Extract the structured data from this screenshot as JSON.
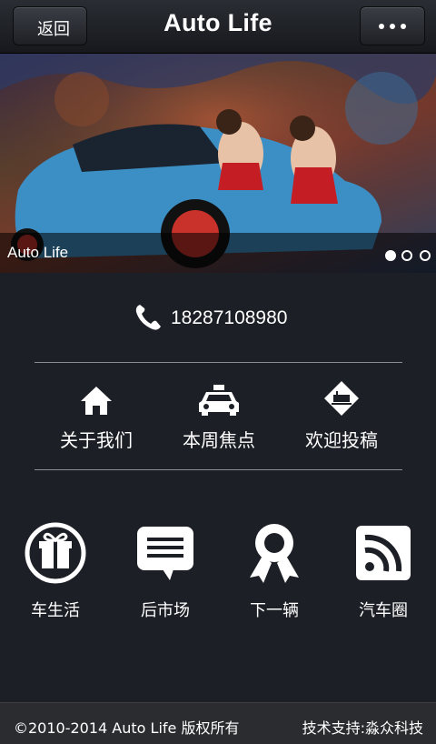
{
  "header": {
    "back_label": "返回",
    "title": "Auto Life",
    "more_icon": "ellipsis-icon"
  },
  "banner": {
    "caption": "Auto Life",
    "slides": 3,
    "active_slide": 1
  },
  "contact": {
    "phone_icon": "phone-icon",
    "phone": "18287108980"
  },
  "nav": [
    {
      "icon": "home-icon",
      "label": "关于我们"
    },
    {
      "icon": "taxi-icon",
      "label": "本周焦点"
    },
    {
      "icon": "train-sign-icon",
      "label": "欢迎投稿"
    }
  ],
  "grid": [
    {
      "icon": "gift-icon",
      "label": "车生活"
    },
    {
      "icon": "message-icon",
      "label": "后市场"
    },
    {
      "icon": "award-ribbon-icon",
      "label": "下一辆"
    },
    {
      "icon": "rss-icon",
      "label": "汽车圈"
    }
  ],
  "footer": {
    "copyright": "©2010-2014 Auto Life 版权所有",
    "support": "技术支持:淼众科技"
  }
}
